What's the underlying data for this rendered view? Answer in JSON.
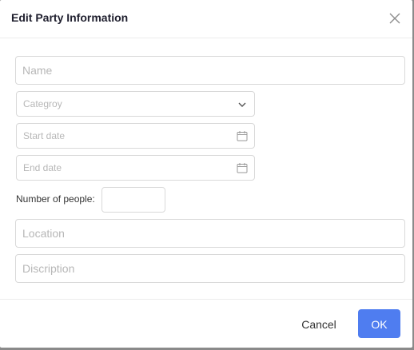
{
  "dialog": {
    "title": "Edit Party Information",
    "close_icon": "close-icon"
  },
  "form": {
    "name_placeholder": "Name",
    "category_placeholder": "Categroy",
    "start_date_placeholder": "Start date",
    "end_date_placeholder": "End date",
    "people_label": "Number of people:",
    "people_value": "",
    "location_placeholder": "Location",
    "description_placeholder": "Discription",
    "calendar_icon": "calendar-icon",
    "dropdown_icon": "chevron-down-icon"
  },
  "footer": {
    "cancel_label": "Cancel",
    "ok_label": "OK"
  },
  "colors": {
    "primary": "#4f7df0",
    "border": "#d9d9d9",
    "placeholder": "#b7b7b7",
    "title": "#1f1f2e"
  }
}
